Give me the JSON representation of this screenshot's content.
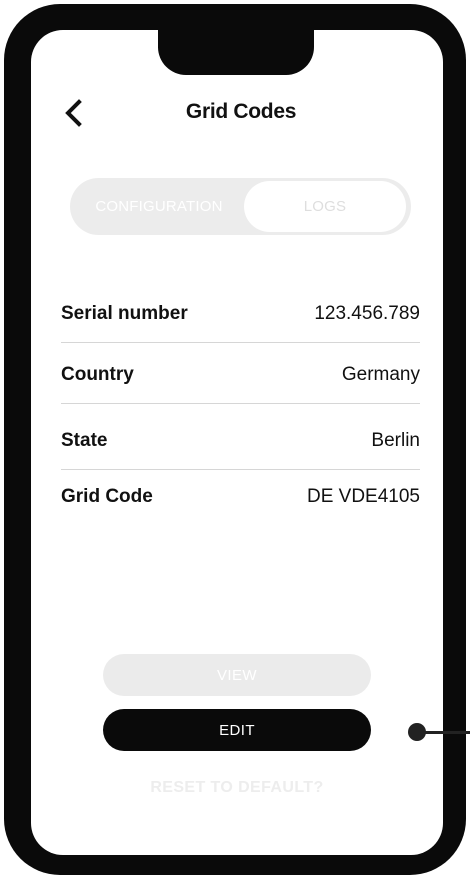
{
  "header": {
    "title": "Grid Codes",
    "back_icon": "chevron-left-icon"
  },
  "tabs": [
    {
      "label": "CONFIGURATION",
      "active": true
    },
    {
      "label": "LOGS",
      "active": false
    }
  ],
  "details": [
    {
      "label": "Serial number",
      "value": "123.456.789"
    },
    {
      "label": "Country",
      "value": "Germany"
    },
    {
      "label": "State",
      "value": "Berlin"
    },
    {
      "label": "Grid Code",
      "value": "DE VDE4105"
    }
  ],
  "actions": {
    "view_label": "VIEW",
    "edit_label": "EDIT",
    "reset_label": "RESET TO DEFAULT?"
  },
  "colors": {
    "frame": "#0a0a0a",
    "primary_button": "#0a0a0a",
    "disabled_button": "#ebebeb"
  }
}
